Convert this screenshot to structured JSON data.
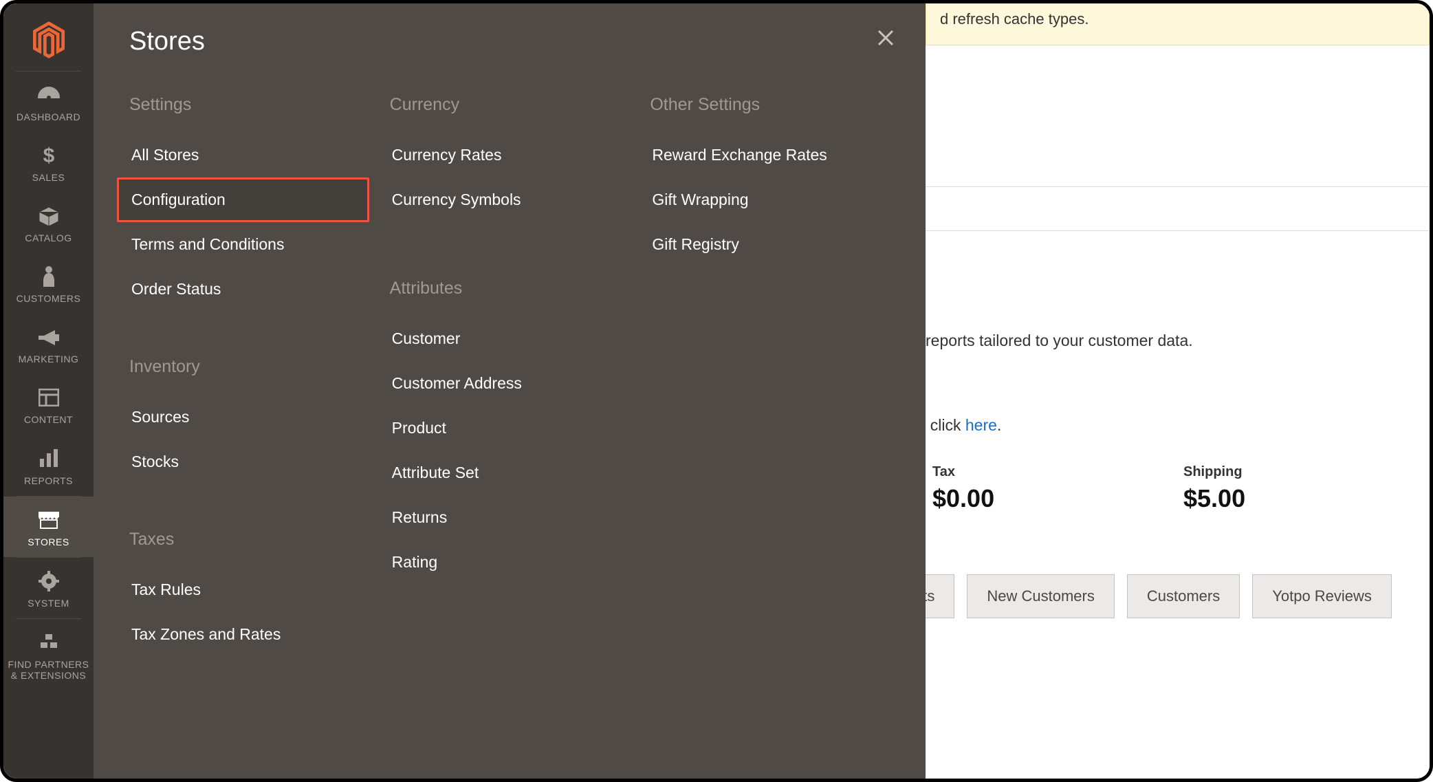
{
  "sidebar": {
    "items": [
      {
        "label": "DASHBOARD",
        "icon": "dashboard"
      },
      {
        "label": "SALES",
        "icon": "dollar"
      },
      {
        "label": "CATALOG",
        "icon": "box"
      },
      {
        "label": "CUSTOMERS",
        "icon": "person"
      },
      {
        "label": "MARKETING",
        "icon": "megaphone"
      },
      {
        "label": "CONTENT",
        "icon": "layout"
      },
      {
        "label": "REPORTS",
        "icon": "bars"
      },
      {
        "label": "STORES",
        "icon": "storefront"
      },
      {
        "label": "SYSTEM",
        "icon": "gear"
      },
      {
        "label": "FIND PARTNERS & EXTENSIONS",
        "icon": "blocks"
      }
    ],
    "active_index": 7
  },
  "flyout": {
    "title": "Stores",
    "groups": {
      "settings": {
        "heading": "Settings",
        "items": [
          "All Stores",
          "Configuration",
          "Terms and Conditions",
          "Order Status"
        ]
      },
      "inventory": {
        "heading": "Inventory",
        "items": [
          "Sources",
          "Stocks"
        ]
      },
      "taxes": {
        "heading": "Taxes",
        "items": [
          "Tax Rules",
          "Tax Zones and Rates"
        ]
      },
      "currency": {
        "heading": "Currency",
        "items": [
          "Currency Rates",
          "Currency Symbols"
        ]
      },
      "attributes": {
        "heading": "Attributes",
        "items": [
          "Customer",
          "Customer Address",
          "Product",
          "Attribute Set",
          "Returns",
          "Rating"
        ]
      },
      "other": {
        "heading": "Other Settings",
        "items": [
          "Reward Exchange Rates",
          "Gift Wrapping",
          "Gift Registry"
        ]
      }
    },
    "highlighted": "Configuration"
  },
  "background": {
    "notice_fragment": "d refresh cache types.",
    "reports_fragment": "reports tailored to your customer data.",
    "click_pre": ", click ",
    "click_link": "here",
    "click_post": ".",
    "metrics": [
      {
        "label": "Tax",
        "value": "$0.00"
      },
      {
        "label": "Shipping",
        "value": "$5.00"
      }
    ],
    "tabs": [
      "ucts",
      "New Customers",
      "Customers",
      "Yotpo Reviews"
    ]
  }
}
